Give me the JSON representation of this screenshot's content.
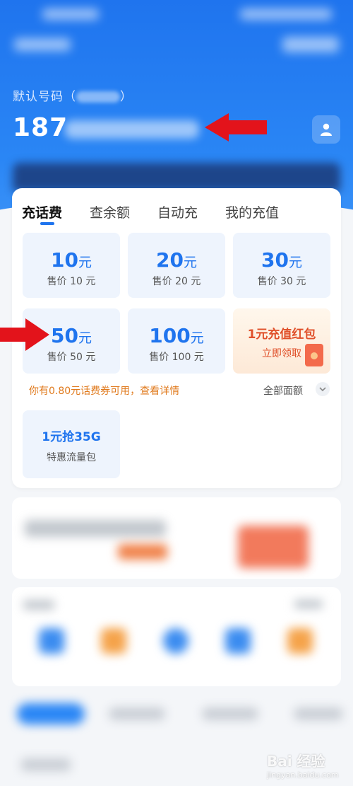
{
  "header": {
    "account_label": "默认号码（",
    "account_label_close": "）",
    "phone_prefix": "187",
    "user_icon": "user-icon"
  },
  "tabs": [
    {
      "label": "充话费",
      "active": true
    },
    {
      "label": "查余额",
      "active": false
    },
    {
      "label": "自动充",
      "active": false
    },
    {
      "label": "我的充值",
      "active": false
    }
  ],
  "tiles": [
    {
      "amount": "10",
      "unit": "元",
      "price": "售价 10 元"
    },
    {
      "amount": "20",
      "unit": "元",
      "price": "售价 20 元"
    },
    {
      "amount": "30",
      "unit": "元",
      "price": "售价 30 元"
    },
    {
      "amount": "50",
      "unit": "元",
      "price": "售价 50 元"
    },
    {
      "amount": "100",
      "unit": "元",
      "price": "售价 100 元"
    }
  ],
  "promo": {
    "title": "1元充值红包",
    "link": "立即领取"
  },
  "coupon_text": "你有0.80元话费券可用，查看详情",
  "all_amounts": "全部面额",
  "flow_pack": {
    "title": "1元抢35G",
    "subtitle": "特惠流量包"
  },
  "watermark": {
    "brand": "Bai 经验",
    "url": "jingyan.baidu.com"
  },
  "colors": {
    "primary": "#1f74ee",
    "accent_orange": "#e0502a",
    "arrow_red": "#e3131b"
  }
}
